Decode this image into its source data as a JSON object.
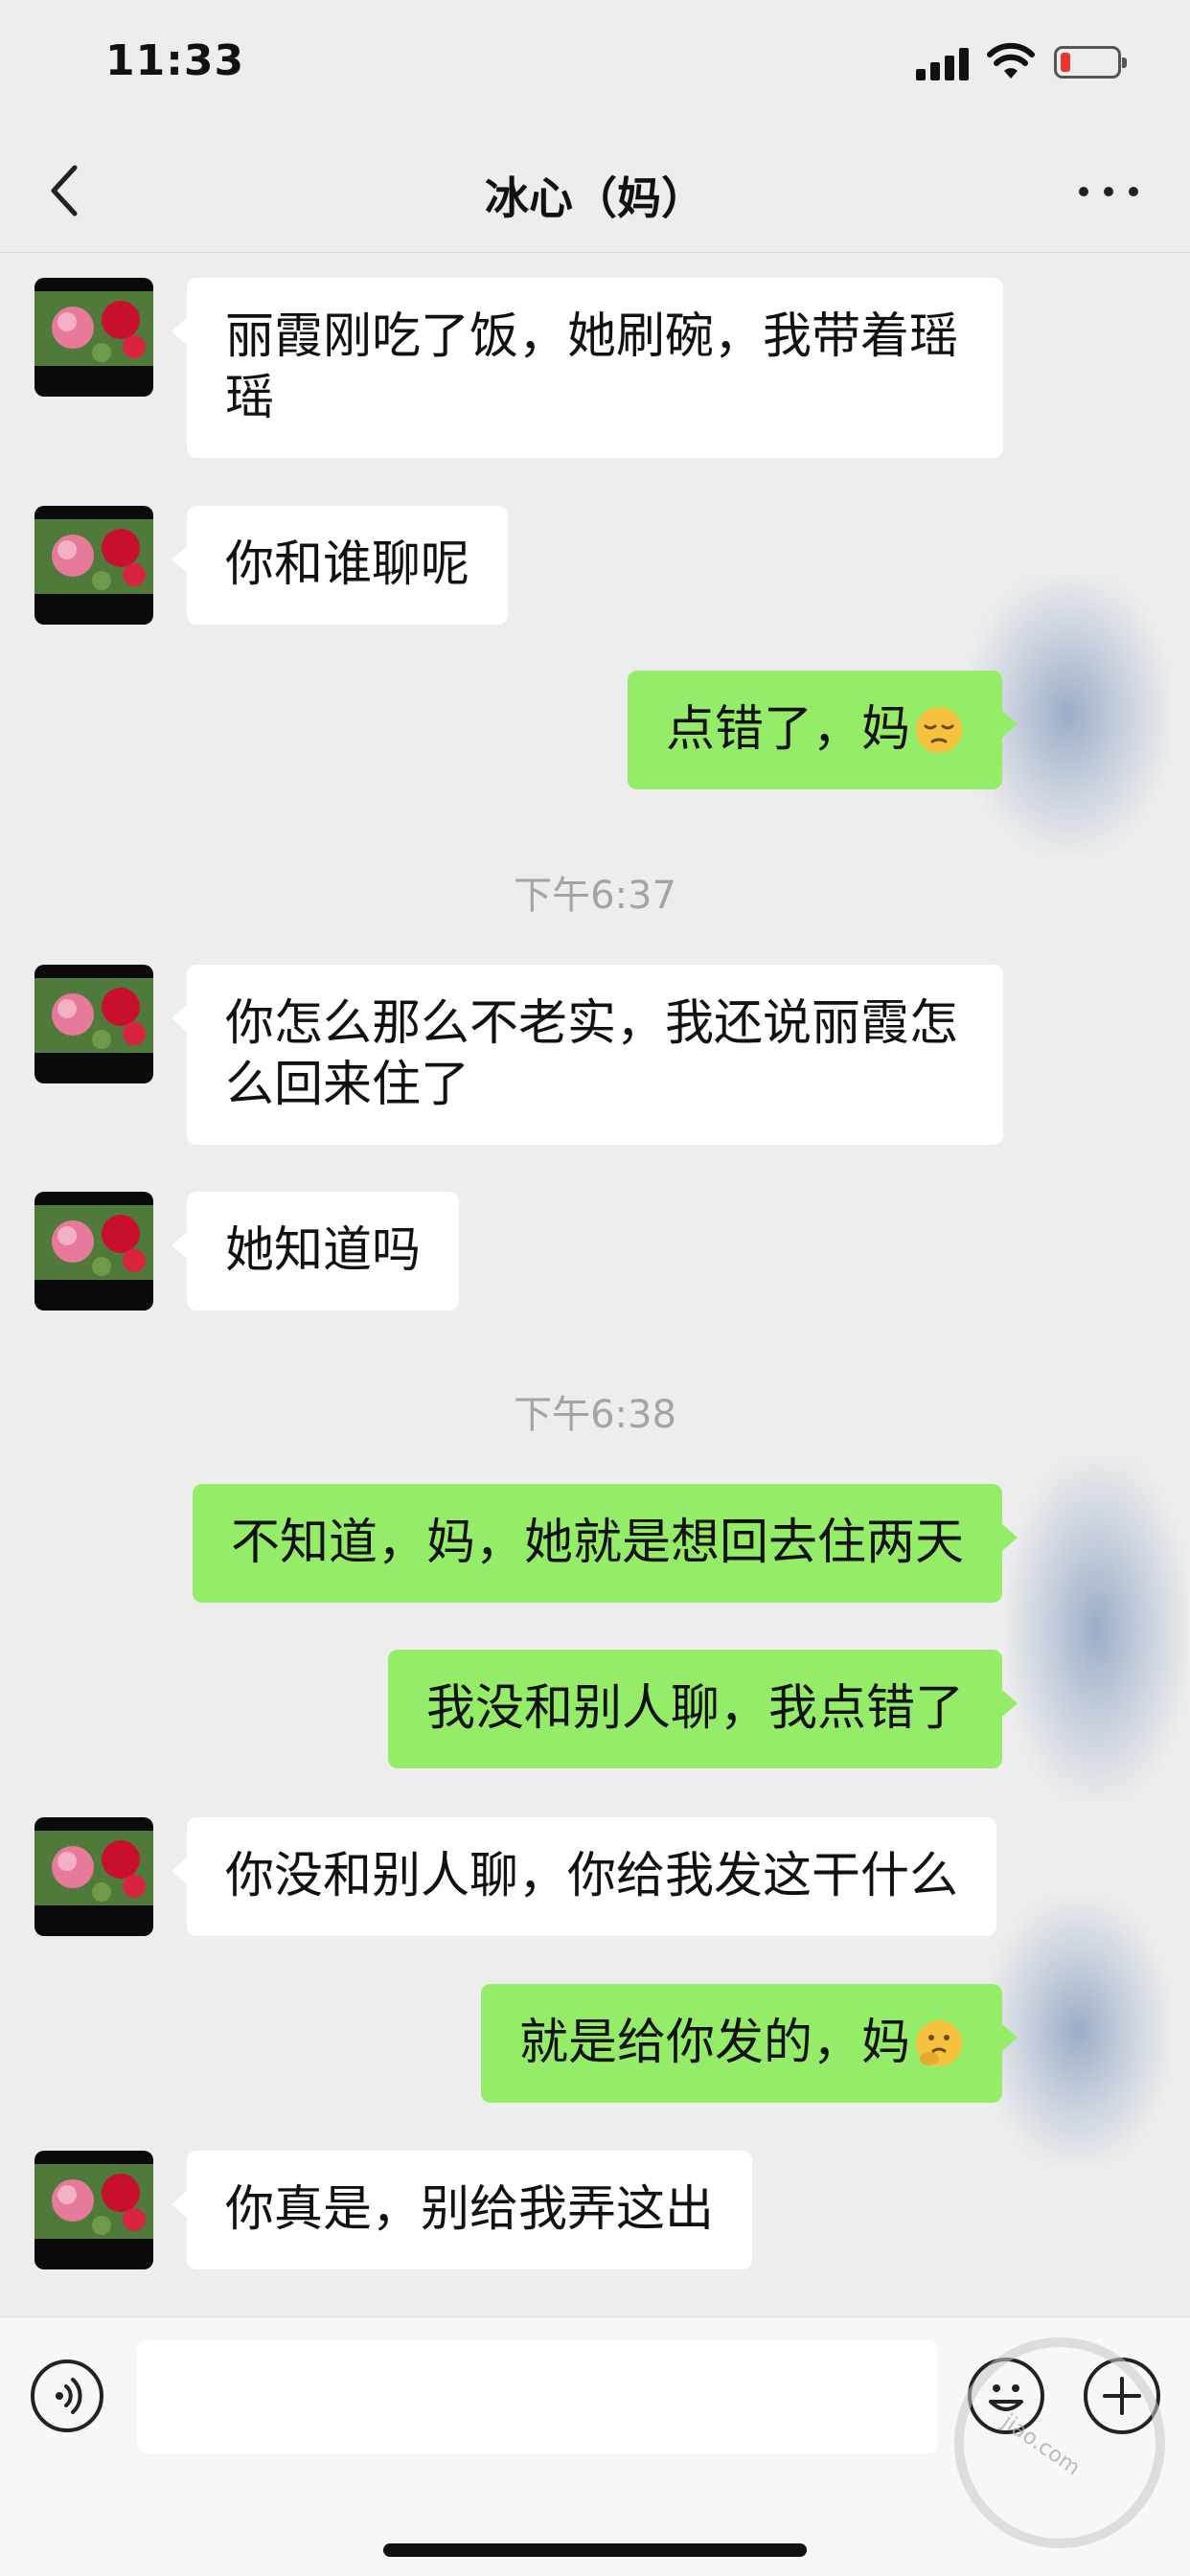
{
  "status_bar": {
    "time": "11:33"
  },
  "header": {
    "title": "冰心（妈）"
  },
  "messages": [
    {
      "text": "丽霞刚吃了饭，她刷碗，我带着瑶瑶"
    },
    {
      "text": "你和谁聊呢"
    },
    {
      "text": "点错了，妈",
      "emoji": "pensive-face-emoji"
    },
    {
      "time": "下午6:37"
    },
    {
      "text": "你怎么那么不老实，我还说丽霞怎么回来住了"
    },
    {
      "text": "她知道吗"
    },
    {
      "time": "下午6:38"
    },
    {
      "text": "不知道，妈，她就是想回去住两天"
    },
    {
      "text": "我没和别人聊，我点错了"
    },
    {
      "text": "你没和别人聊，你给我发这干什么"
    },
    {
      "text": "就是给你发的，妈",
      "emoji": "thinking-face-emoji"
    },
    {
      "text": "你真是，别给我弄这出"
    }
  ],
  "input": {
    "placeholder": ""
  },
  "watermark": {
    "text": "jiao.com"
  },
  "colors": {
    "background": "#ededed",
    "incoming": "#ffffff",
    "outgoing": "#95ec69",
    "timestamp": "#a4a4a4"
  },
  "icons": [
    "back-icon",
    "more-icon",
    "voice-icon",
    "emoji-icon",
    "plus-icon"
  ]
}
